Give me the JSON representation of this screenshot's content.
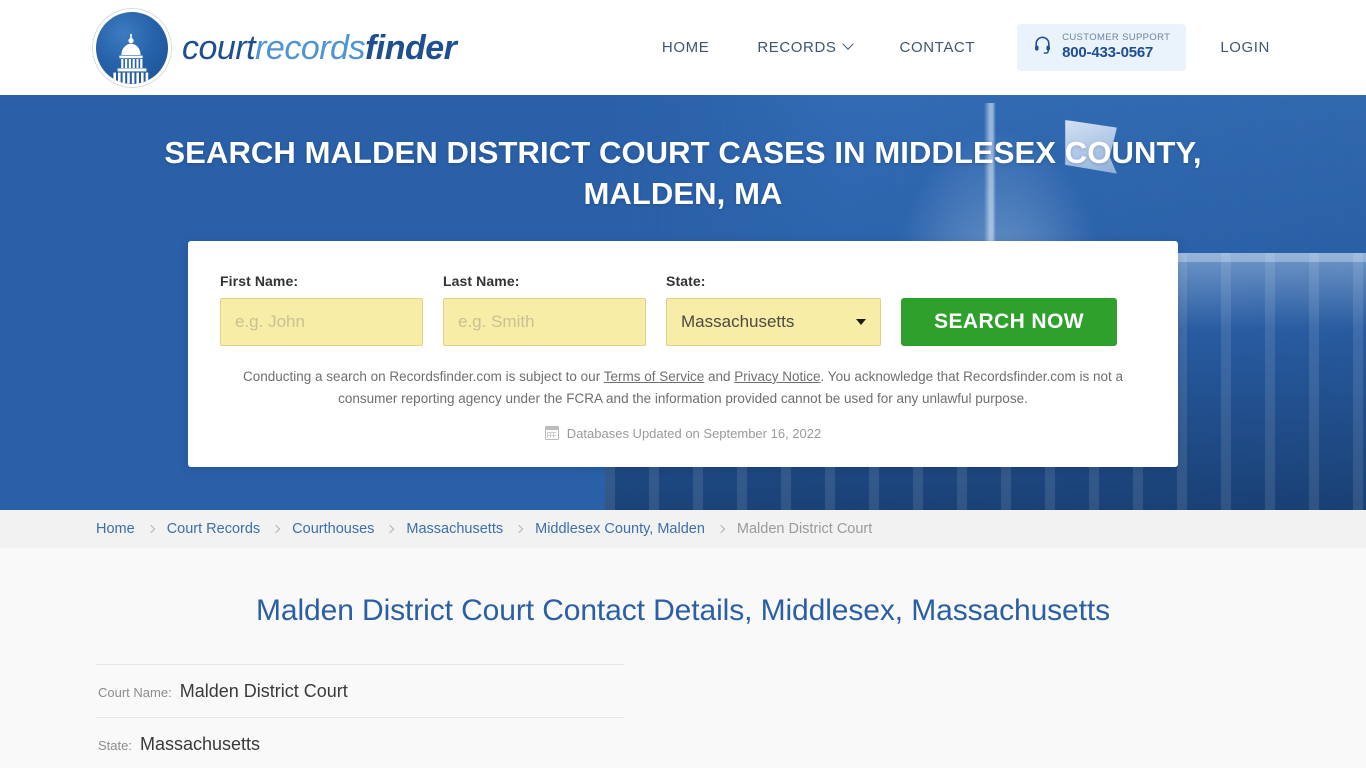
{
  "header": {
    "brand": {
      "part1": "court",
      "part2": "records",
      "part3": "finder",
      "logo_icon": "capitol-dome-icon"
    },
    "nav": [
      {
        "label": "HOME"
      },
      {
        "label": "RECORDS"
      },
      {
        "label": "CONTACT"
      },
      {
        "label": "LOGIN"
      }
    ],
    "support": {
      "label": "CUSTOMER SUPPORT",
      "phone": "800-433-0567",
      "icon": "headset-icon"
    }
  },
  "hero": {
    "title": "SEARCH MALDEN DISTRICT COURT CASES IN MIDDLESEX COUNTY, MALDEN, MA",
    "background_color": "#2a60a8"
  },
  "search": {
    "first_name": {
      "label": "First Name:",
      "value": "",
      "placeholder": "e.g. John"
    },
    "last_name": {
      "label": "Last Name:",
      "value": "",
      "placeholder": "e.g. Smith"
    },
    "state": {
      "label": "State:",
      "value": "Massachusetts"
    },
    "submit_label": "SEARCH NOW",
    "submit_color": "#2ea12c",
    "disclaimer": {
      "part1": "Conducting a search on Recordsfinder.com is subject to our ",
      "link1": "Terms of Service",
      "part2": " and ",
      "link2": "Privacy Notice",
      "part3": ". You acknowledge that Recordsfinder.com is not a consumer reporting agency under the FCRA and the information provided cannot be used for any unlawful purpose."
    },
    "databases_updated": "Databases Updated on September 16, 2022",
    "databases_icon": "calendar-icon"
  },
  "breadcrumb": [
    {
      "label": "Home",
      "current": false
    },
    {
      "label": "Court Records",
      "current": false
    },
    {
      "label": "Courthouses",
      "current": false
    },
    {
      "label": "Massachusetts",
      "current": false
    },
    {
      "label": "Middlesex County, Malden",
      "current": false
    },
    {
      "label": "Malden District Court",
      "current": true
    }
  ],
  "content": {
    "page_title": "Malden District Court Contact Details, Middlesex, Massachusetts",
    "details": [
      {
        "label": "Court Name:",
        "value": "Malden District Court"
      },
      {
        "label": "State:",
        "value": "Massachusetts"
      }
    ]
  }
}
